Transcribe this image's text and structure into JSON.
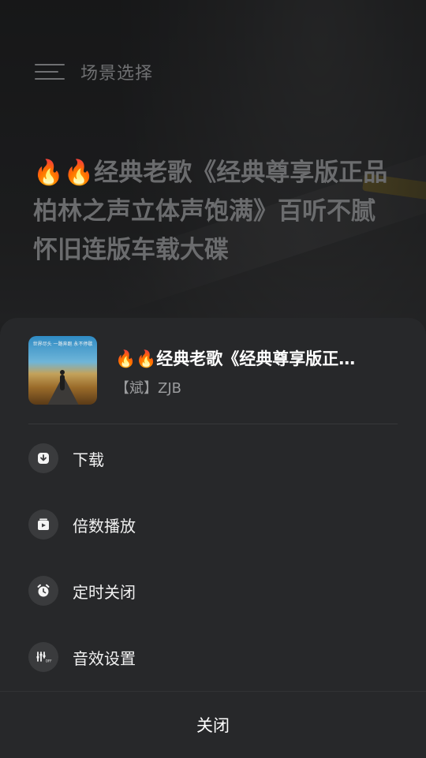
{
  "top_bar": {
    "title": "场景选择"
  },
  "background_song": {
    "title": "🔥🔥经典老歌《经典尊享版正品柏林之声立体声饱满》百听不腻怀旧连版车载大碟"
  },
  "sheet": {
    "title": "🔥🔥经典老歌《经典尊享版正…",
    "subtitle": "【斌】ZJB",
    "cover_text": "世界尽头 一路奔跑 永不停歇",
    "menu": [
      {
        "label": "下载",
        "icon": "download-icon"
      },
      {
        "label": "倍数播放",
        "icon": "playback-speed-icon"
      },
      {
        "label": "定时关闭",
        "icon": "alarm-clock-icon"
      },
      {
        "label": "音效设置",
        "icon": "equalizer-icon"
      }
    ],
    "close_label": "关闭"
  }
}
